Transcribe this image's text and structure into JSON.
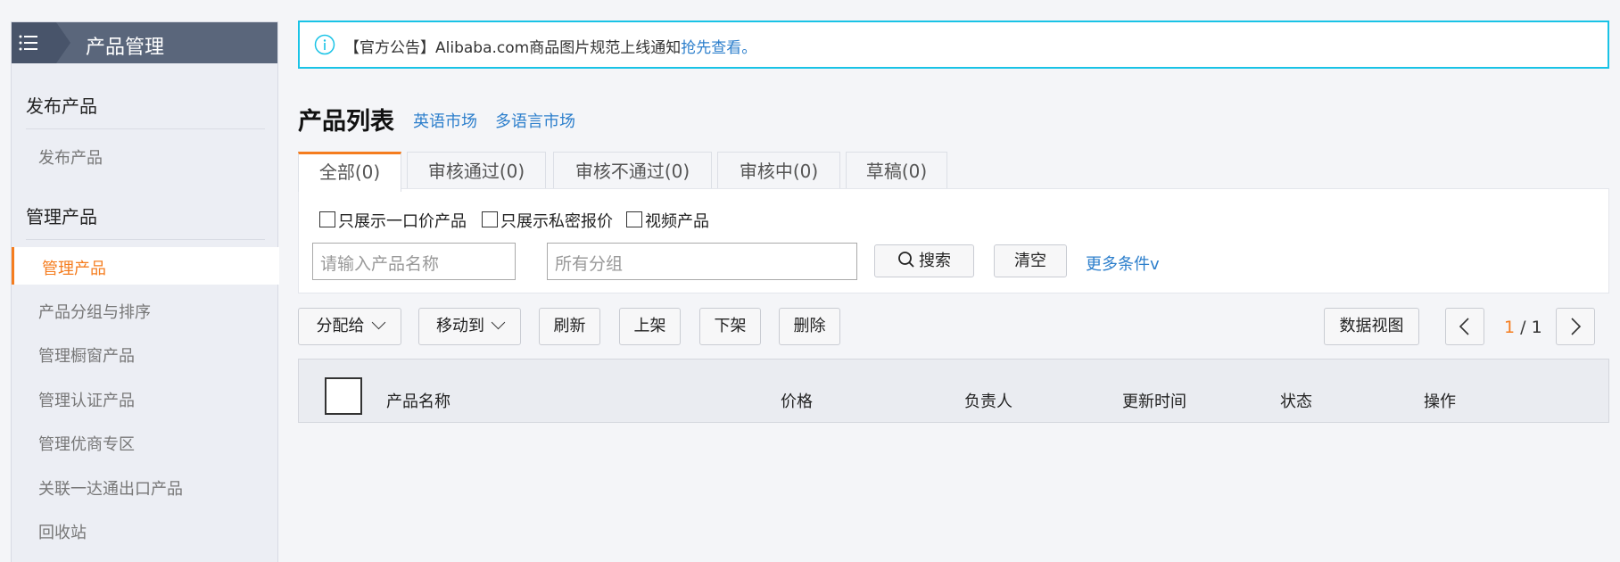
{
  "sidebar": {
    "title": "产品管理",
    "sections": [
      {
        "heading": "发布产品",
        "items": [
          "发布产品"
        ]
      },
      {
        "heading": "管理产品",
        "items": [
          "管理产品",
          "产品分组与排序",
          "管理橱窗产品",
          "管理认证产品",
          "管理优商专区",
          "关联一达通出口产品",
          "回收站"
        ]
      }
    ],
    "active_item": "管理产品"
  },
  "notice": {
    "text": "【官方公告】Alibaba.com商品图片规范上线通知",
    "link": "抢先查看。"
  },
  "page": {
    "title": "产品列表",
    "markets": [
      "英语市场",
      "多语言市场"
    ]
  },
  "tabs": [
    {
      "label": "全部(0)",
      "active": true
    },
    {
      "label": "审核通过(0)"
    },
    {
      "label": "审核不通过(0)"
    },
    {
      "label": "审核中(0)"
    },
    {
      "label": "草稿(0)"
    }
  ],
  "filters": {
    "checkboxes": [
      "只展示一口价产品",
      "只展示私密报价",
      "视频产品"
    ],
    "name_placeholder": "请输入产品名称",
    "group_placeholder": "所有分组",
    "search_label": "搜索",
    "clear_label": "清空",
    "more_label": "更多条件v"
  },
  "toolbar": {
    "assign": "分配给",
    "move": "移动到",
    "refresh": "刷新",
    "shelve": "上架",
    "unshelve": "下架",
    "delete": "删除",
    "data_view": "数据视图"
  },
  "pagination": {
    "current": "1",
    "total": " / 1"
  },
  "table": {
    "columns": [
      "产品名称",
      "价格",
      "负责人",
      "更新时间",
      "状态",
      "操作"
    ]
  },
  "colors": {
    "accent": "#f57d1f",
    "link": "#2d7fcc",
    "notice_border": "#19c3e6",
    "sidebar_header": "#5a667b"
  }
}
